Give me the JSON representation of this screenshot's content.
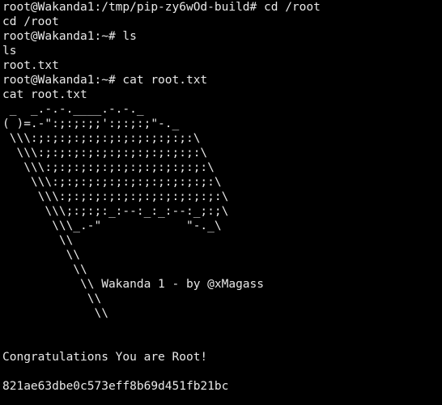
{
  "terminal": {
    "lines": [
      "root@Wakanda1:/tmp/pip-zy6wOd-build# cd /root",
      "cd /root",
      "root@Wakanda1:~# ls",
      "ls",
      "root.txt",
      "root@Wakanda1:~# cat root.txt",
      "cat root.txt",
      " _  _.-.-.____.-.-._",
      "( )=.-\":;:;:;;':;:;:;\"-._",
      " \\\\\\:;:;:;:;:;:;:;:;:;:;:;:\\",
      "  \\\\\\:;:;:;:;:;:;:;:;:;:;:;:\\",
      "   \\\\\\:;:;:;:;:;:;:;:;:;:;:;:\\",
      "    \\\\\\:;:;:;:;:;:;:;:;:;:;:;:\\",
      "     \\\\\\:;:;:;:;:;:;:;:;:;:;:;:\\",
      "      \\\\\\;:;:;:_:--:_:_:--:_;:;\\",
      "       \\\\\\_.-\"            \"-._\\",
      "        \\\\",
      "         \\\\",
      "          \\\\",
      "           \\\\ Wakanda 1 - by @xMagass",
      "            \\\\",
      "             \\\\",
      "",
      "",
      "Congratulations You are Root!",
      "",
      "821ae63dbe0c573eff8b69d451fb21bc",
      ""
    ]
  }
}
